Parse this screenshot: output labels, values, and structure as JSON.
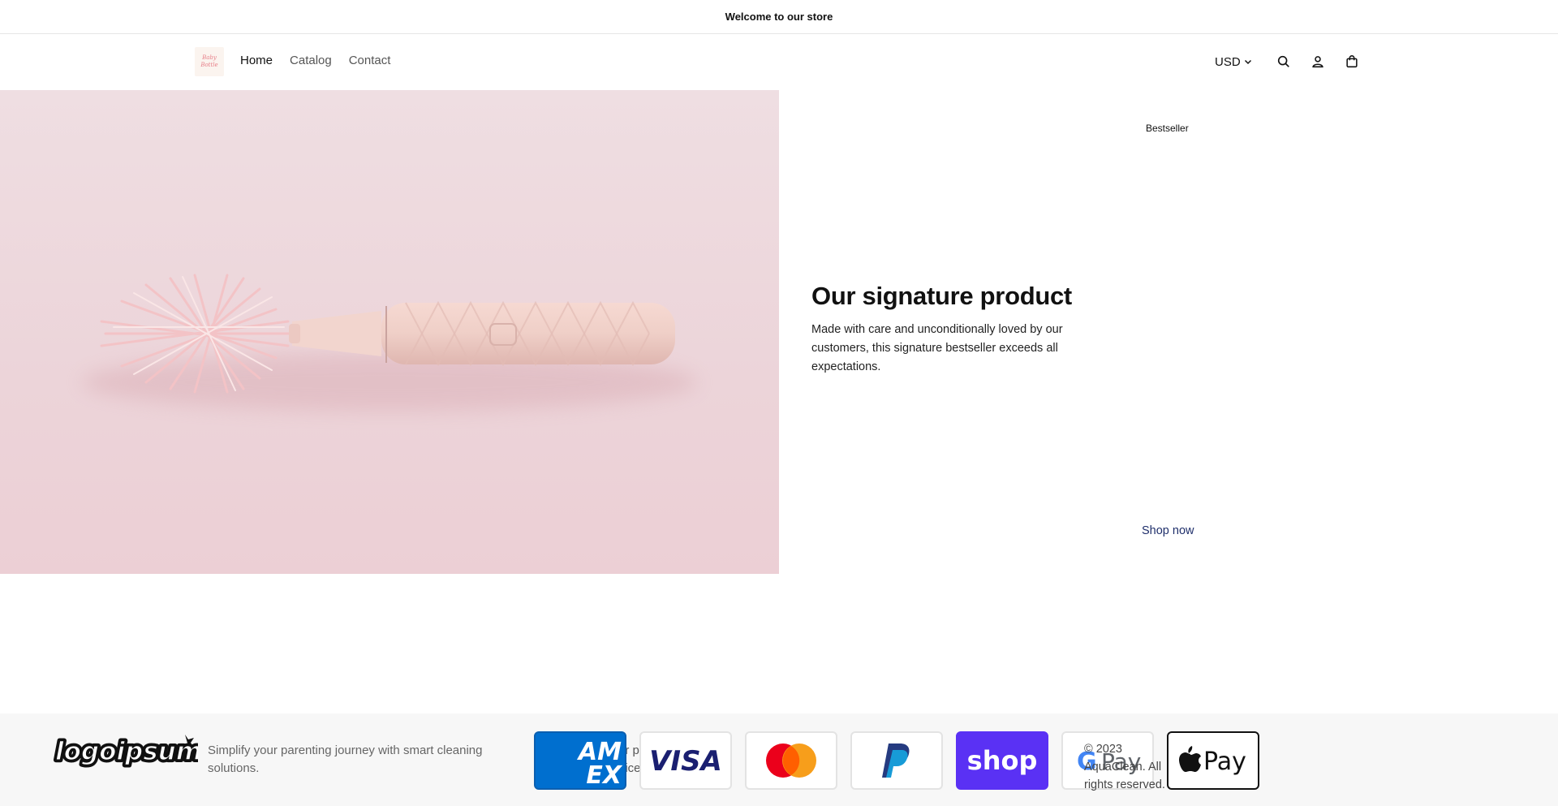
{
  "announcement": {
    "text": "Welcome to our store"
  },
  "header": {
    "logo_text": "Baby Bottle",
    "nav": [
      {
        "label": "Home",
        "active": true
      },
      {
        "label": "Catalog",
        "active": false
      },
      {
        "label": "Contact",
        "active": false
      }
    ],
    "currency": "USD",
    "icons": [
      "search-icon",
      "account-icon",
      "cart-icon"
    ]
  },
  "hero": {
    "badge": "Bestseller",
    "title": "Our signature product",
    "description": "Made with care and unconditionally loved by our customers, this signature bestseller exceeds all expectations.",
    "cta": "Shop now"
  },
  "footer": {
    "logo_text": "logoipsum",
    "tagline": "Simplify your parenting journey with smart cleaning solutions.",
    "overlap_text": "ur p\noice",
    "payment_methods": [
      "American Express",
      "Visa",
      "Mastercard",
      "PayPal",
      "Shop Pay",
      "Google Pay",
      "Apple Pay"
    ],
    "amex_text": "AM EX",
    "visa_text": "VISA",
    "shop_text": "shop",
    "gpay_text": "Pay",
    "applepay_text": "Pay",
    "copyright": "© 2023 AquaClean. All rights reserved."
  },
  "colors": {
    "hero_bg": "#ecd4d9",
    "link": "#1f2f6b",
    "shop_pay": "#5a31f4",
    "amex": "#006fcf",
    "visa": "#1a1f71"
  }
}
